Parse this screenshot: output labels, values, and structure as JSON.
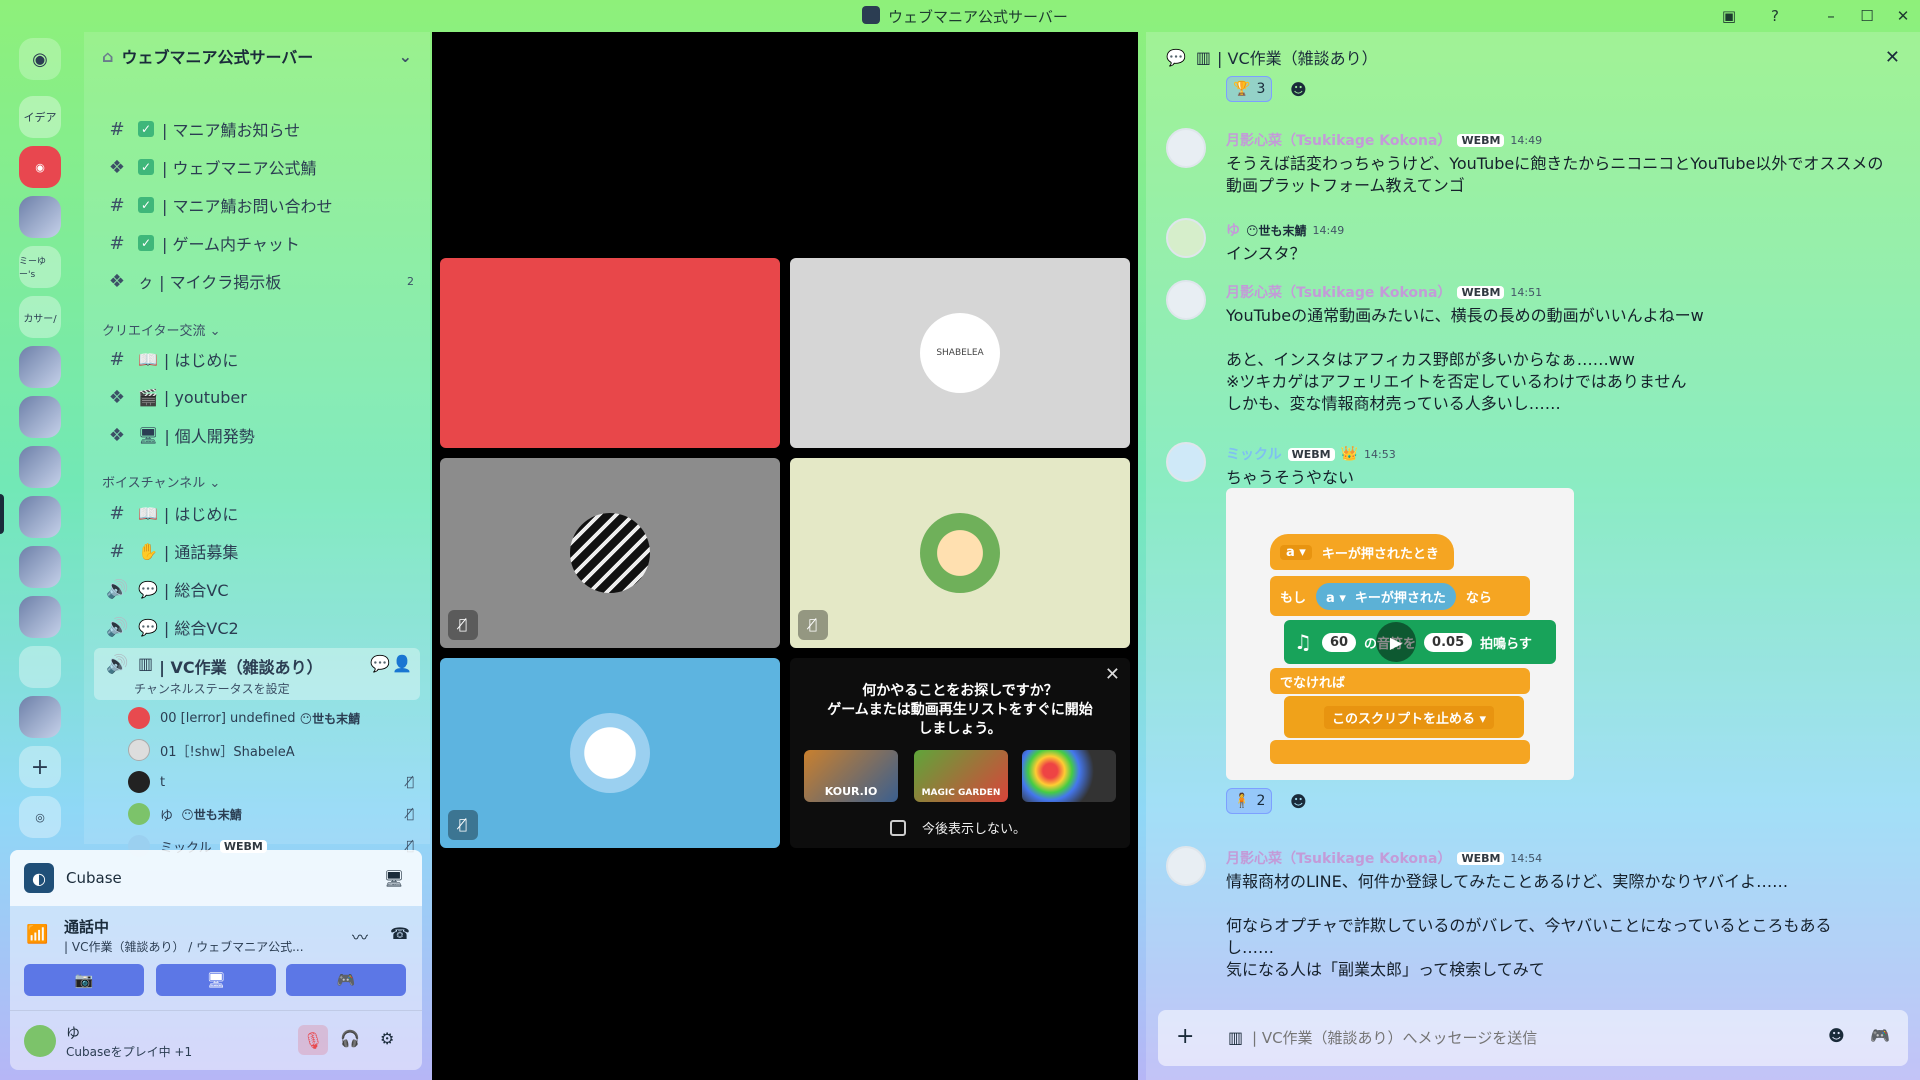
{
  "window": {
    "title": "ウェブマニア公式サーバー"
  },
  "rail": {
    "items": [
      "イデア",
      "ミーゆー's",
      "カサー/"
    ]
  },
  "guild": {
    "name": "ウェブマニア公式サーバー"
  },
  "channels": [
    {
      "label": "| マニア鯖お知らせ"
    },
    {
      "label": "| ウェブマニア公式鯖"
    },
    {
      "label": "| マニア鯖お問い合わせ"
    },
    {
      "label": "| ゲーム内チャット"
    },
    {
      "label": "ㇰ | マイクラ掲示板",
      "badge": "2"
    }
  ],
  "categories": {
    "creator": "クリエイター交流",
    "voice": "ボイスチャンネル"
  },
  "creator_channels": [
    {
      "label": "| はじめに"
    },
    {
      "label": "| youtuber"
    },
    {
      "label": "| 個人開発勢"
    }
  ],
  "voice_channels": [
    {
      "label": "| はじめに"
    },
    {
      "label": "| 通話募集"
    },
    {
      "label": "| 総合VC"
    },
    {
      "label": "| 総合VC2"
    },
    {
      "label": "| VC作業（雑談あり）"
    }
  ],
  "active_channel": {
    "status": "チャンネルステータスを設定"
  },
  "voice_users": [
    {
      "name": "00 [lerror] undefined",
      "tag": "😶世も末鯖"
    },
    {
      "name": "01［!shw］ShabeleA",
      "tag": ""
    },
    {
      "name": "t",
      "tag": ""
    },
    {
      "name": "ゆ",
      "tag": "😶世も末鯖"
    },
    {
      "name": "ミックル",
      "tag": "WEBM"
    }
  ],
  "activity": {
    "app": "Cubase",
    "status": "通話中",
    "location": "| VC作業（雑談あり） / ウェブマニア公式..."
  },
  "user": {
    "name": "ゆ",
    "status": "Cubaseをプレイ中 +1"
  },
  "stage": {
    "tiles": [
      {
        "label": "SHABELEA"
      }
    ],
    "prompt": {
      "line1": "何かやることをお探しですか？",
      "line2": "ゲームまたは動画再生リストをすぐに開始",
      "line3": "しましょう。",
      "games": [
        "KOUR.IO",
        "MAGIC GARDEN",
        ""
      ],
      "checkbox": "今後表示しない。"
    }
  },
  "chat": {
    "channel": "| VC作業（雑談あり）",
    "top_reaction": "3",
    "messages": [
      {
        "name": "月影心菜（Tsukikage Kokona）",
        "tag": "WEBM",
        "time": "14:49",
        "lines": [
          "そうえば話変わっちゃうけど、YouTubeに飽きたからニコニコとYouTube以外でオススメの",
          "動画プラットフォーム教えてンゴ"
        ]
      },
      {
        "name": "ゆ",
        "tag": "😶世も末鯖",
        "time": "14:49",
        "lines": [
          "インスタ？"
        ]
      },
      {
        "name": "月影心菜（Tsukikage Kokona）",
        "tag": "WEBM",
        "time": "14:51",
        "lines": [
          "YouTubeの通常動画みたいに、横長の長めの動画がいいんよねーw",
          "",
          "あと、インスタはアフィカス野郎が多いからなぁ……ww",
          "※ツキカゲはアフェリエイトを否定しているわけではありません",
          "しかも、変な情報商材売っている人多いし……"
        ]
      },
      {
        "name": "ミックル",
        "tag": "WEBM",
        "time": "14:53",
        "lines": [
          "ちゃうそうやない"
        ]
      },
      {
        "name": "月影心菜（Tsukikage Kokona）",
        "tag": "WEBM",
        "time": "14:54",
        "lines": [
          "情報商材のLINE、何件か登録してみたことあるけど、実際かなりヤバイよ……",
          "",
          "何ならオプチャで詐欺しているのがバレて、今ヤバいことになっているところもある",
          "し……",
          "気になる人は「副業太郎」って検索してみて"
        ]
      }
    ],
    "embed": {
      "hat_key": "a ▾",
      "hat_text": "キーが押されたとき",
      "if_word": "もし",
      "cond_key": "a ▾",
      "cond_text": "キーが押された",
      "then_word": "なら",
      "note_val": "60",
      "note_mid": "の音符を",
      "beats_val": "0.05",
      "note_end": "拍鳴らす",
      "else_word": "でなければ",
      "stop_text": "このスクリプトを止める ▾"
    },
    "embed_reaction": "2",
    "placeholder": "| VC作業（雑談あり）へメッセージを送信"
  }
}
